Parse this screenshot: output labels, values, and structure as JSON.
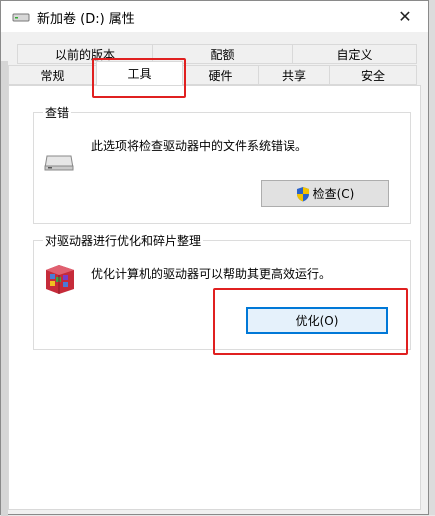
{
  "window": {
    "title": "新加卷 (D:) 属性",
    "close_glyph": "✕"
  },
  "tabs_row1": [
    {
      "label": "以前的版本"
    },
    {
      "label": "配额"
    },
    {
      "label": "自定义"
    }
  ],
  "tabs_row2": [
    {
      "label": "常规"
    },
    {
      "label": "工具"
    },
    {
      "label": "硬件"
    },
    {
      "label": "共享"
    },
    {
      "label": "安全"
    }
  ],
  "active_tab": "工具",
  "check_group": {
    "title": "查错",
    "description": "此选项将检查驱动器中的文件系统错误。",
    "button_label": "检查(C)"
  },
  "optimize_group": {
    "title": "对驱动器进行优化和碎片整理",
    "description": "优化计算机的驱动器可以帮助其更高效运行。",
    "button_label": "优化(O)"
  },
  "colors": {
    "highlight": "#e02020",
    "focus_border": "#0078d7"
  },
  "icons": [
    "drive-icon",
    "close-icon",
    "uac-shield-icon",
    "defrag-icon"
  ]
}
